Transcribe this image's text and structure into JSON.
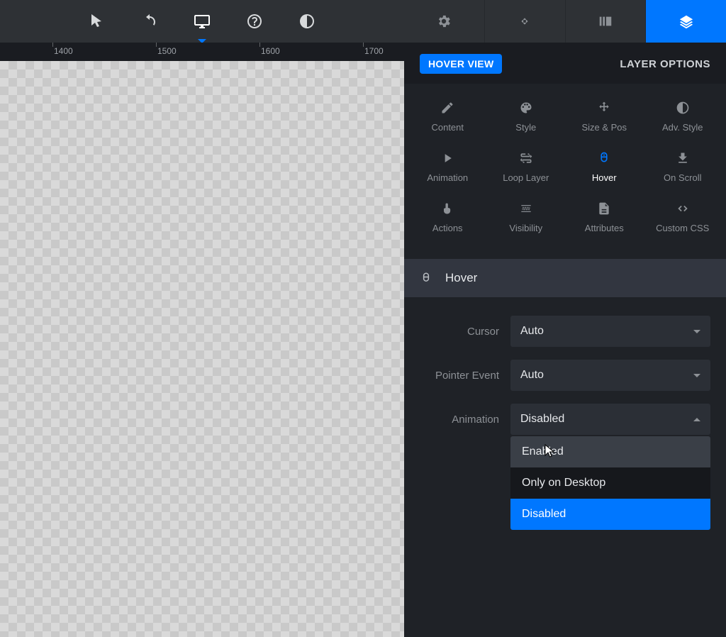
{
  "ruler": {
    "t1": "1400",
    "t2": "1500",
    "t3": "1600",
    "t4": "1700"
  },
  "panel": {
    "badge": "HOVER VIEW",
    "title": "LAYER OPTIONS"
  },
  "categories": {
    "content": "Content",
    "style": "Style",
    "sizepos": "Size & Pos",
    "advstyle": "Adv. Style",
    "animation": "Animation",
    "looplayer": "Loop Layer",
    "hover": "Hover",
    "onscroll": "On Scroll",
    "actions": "Actions",
    "visibility": "Visibility",
    "attributes": "Attributes",
    "customcss": "Custom CSS"
  },
  "section": {
    "title": "Hover"
  },
  "form": {
    "cursor_label": "Cursor",
    "cursor_value": "Auto",
    "pointer_label": "Pointer Event",
    "pointer_value": "Auto",
    "animation_label": "Animation",
    "animation_value": "Disabled",
    "options": {
      "enabled": "Enabled",
      "desktop": "Only on Desktop",
      "disabled": "Disabled"
    }
  }
}
